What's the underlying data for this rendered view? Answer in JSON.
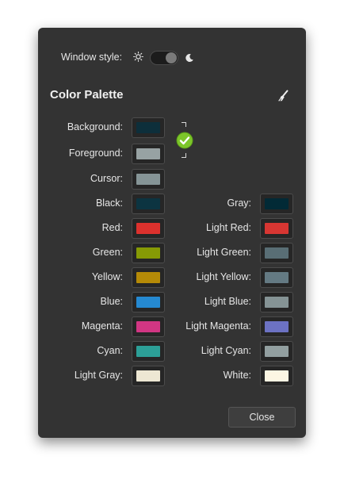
{
  "window_style": {
    "label": "Window style:",
    "mode": "dark"
  },
  "palette": {
    "title": "Color Palette"
  },
  "top_rows": [
    {
      "label": "Background:",
      "color": "#0d2f3b"
    },
    {
      "label": "Foreground:",
      "color": "#97a2a3"
    },
    {
      "label": "Cursor:",
      "color": "#859496"
    }
  ],
  "left_rows": [
    {
      "label": "Black:",
      "color": "#0c3441"
    },
    {
      "label": "Red:",
      "color": "#dc312d"
    },
    {
      "label": "Green:",
      "color": "#869a05"
    },
    {
      "label": "Yellow:",
      "color": "#b58a07"
    },
    {
      "label": "Blue:",
      "color": "#2589d1"
    },
    {
      "label": "Magenta:",
      "color": "#d13683"
    },
    {
      "label": "Cyan:",
      "color": "#2c9f97"
    },
    {
      "label": "Light Gray:",
      "color": "#ede7d3"
    }
  ],
  "right_rows": [
    {
      "label": "Gray:",
      "color": "#022a36"
    },
    {
      "label": "Light Red:",
      "color": "#d73632"
    },
    {
      "label": "Light Green:",
      "color": "#596e75"
    },
    {
      "label": "Light Yellow:",
      "color": "#647a83"
    },
    {
      "label": "Light Blue:",
      "color": "#859395"
    },
    {
      "label": "Light Magenta:",
      "color": "#6c72c3"
    },
    {
      "label": "Light Cyan:",
      "color": "#929fa0"
    },
    {
      "label": "White:",
      "color": "#fcf6e3"
    }
  ],
  "close_label": "Close",
  "accent": "#7cc62a"
}
